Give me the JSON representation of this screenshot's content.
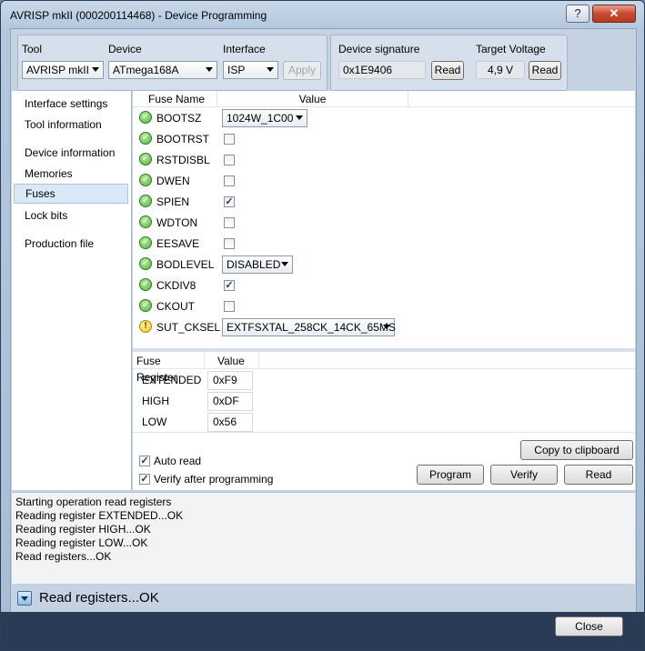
{
  "window": {
    "title": "AVRISP mkII (000200114468) - Device Programming",
    "help_glyph": "?",
    "close_glyph": "✕"
  },
  "tool_group": {
    "tool_label": "Tool",
    "tool_value": "AVRISP mkII",
    "device_label": "Device",
    "device_value": "ATmega168A",
    "interface_label": "Interface",
    "interface_value": "ISP",
    "apply_label": "Apply"
  },
  "signature_group": {
    "sig_label": "Device signature",
    "sig_value": "0x1E9406",
    "sig_read": "Read",
    "voltage_label": "Target Voltage",
    "voltage_value": "4,9 V",
    "voltage_read": "Read"
  },
  "nav": {
    "items": [
      "Interface settings",
      "Tool information",
      "Device information",
      "Memories",
      "Fuses",
      "Lock bits",
      "Production file"
    ],
    "selected": "Fuses"
  },
  "fuses": {
    "col_name": "Fuse Name",
    "col_value": "Value",
    "rows": [
      {
        "name": "BOOTSZ",
        "status": "ok",
        "kind": "combo",
        "value": "1024W_1C00"
      },
      {
        "name": "BOOTRST",
        "status": "ok",
        "kind": "check",
        "checked": false
      },
      {
        "name": "RSTDISBL",
        "status": "ok",
        "kind": "check",
        "checked": false
      },
      {
        "name": "DWEN",
        "status": "ok",
        "kind": "check",
        "checked": false
      },
      {
        "name": "SPIEN",
        "status": "ok",
        "kind": "check",
        "checked": true
      },
      {
        "name": "WDTON",
        "status": "ok",
        "kind": "check",
        "checked": false
      },
      {
        "name": "EESAVE",
        "status": "ok",
        "kind": "check",
        "checked": false
      },
      {
        "name": "BODLEVEL",
        "status": "ok",
        "kind": "combo",
        "value": "DISABLED"
      },
      {
        "name": "CKDIV8",
        "status": "ok",
        "kind": "check",
        "checked": true
      },
      {
        "name": "CKOUT",
        "status": "ok",
        "kind": "check",
        "checked": false
      },
      {
        "name": "SUT_CKSEL",
        "status": "warn",
        "kind": "combo",
        "value": "EXTFSXTAL_258CK_14CK_65MS"
      }
    ]
  },
  "registers": {
    "col_name": "Fuse Register",
    "col_value": "Value",
    "rows": [
      {
        "name": "EXTENDED",
        "value": "0xF9"
      },
      {
        "name": "HIGH",
        "value": "0xDF"
      },
      {
        "name": "LOW",
        "value": "0x56"
      }
    ]
  },
  "actions": {
    "auto_read": "Auto read",
    "auto_read_checked": true,
    "verify_after": "Verify after programming",
    "verify_after_checked": true,
    "copy": "Copy to clipboard",
    "program": "Program",
    "verify": "Verify",
    "read": "Read"
  },
  "log": {
    "lines": [
      "Starting operation read registers",
      "Reading register EXTENDED...OK",
      "Reading register HIGH...OK",
      "Reading register LOW...OK",
      "Read registers...OK"
    ]
  },
  "status": {
    "text": "Read registers...OK"
  },
  "footer": {
    "close": "Close"
  }
}
